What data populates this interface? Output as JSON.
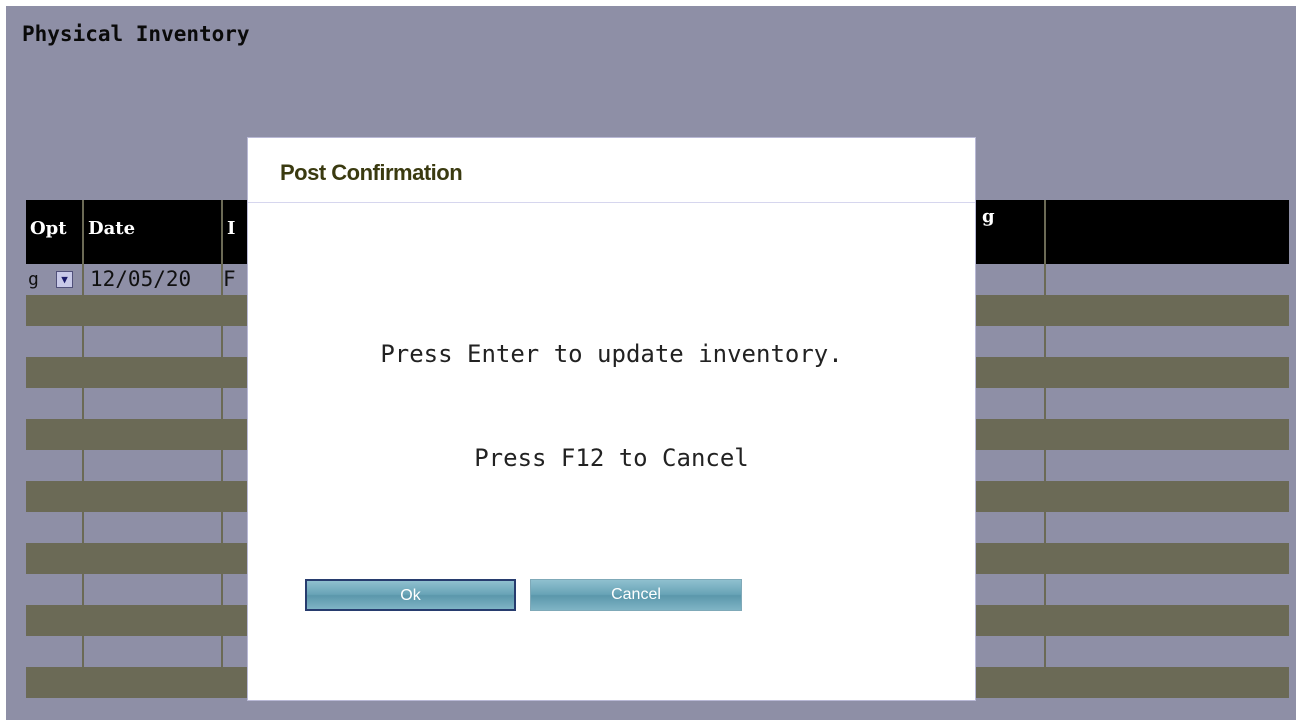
{
  "page": {
    "title": "Physical Inventory"
  },
  "grid": {
    "columns": [
      {
        "id": "opt",
        "label": "Opt"
      },
      {
        "id": "date",
        "label": "Date"
      },
      {
        "id": "item",
        "label": "I"
      },
      {
        "id": "hidden",
        "label": ""
      },
      {
        "id": "status",
        "label": "g"
      },
      {
        "id": "last",
        "label": ""
      }
    ],
    "first_row": {
      "opt": "g",
      "date": "12/05/20",
      "item": "F"
    },
    "opt_dropdown_icon": "chevron-down-icon"
  },
  "dialog": {
    "title": "Post Confirmation",
    "message": "Press Enter to update inventory.",
    "cancel_hint": "Press F12 to Cancel",
    "ok_label": "Ok",
    "cancel_label": "Cancel"
  },
  "colors": {
    "background": "#8e8fa6",
    "row_dark": "#6b6a56",
    "header": "#000000",
    "button": "#68a3b6",
    "button_border_focus": "#273c6e"
  }
}
